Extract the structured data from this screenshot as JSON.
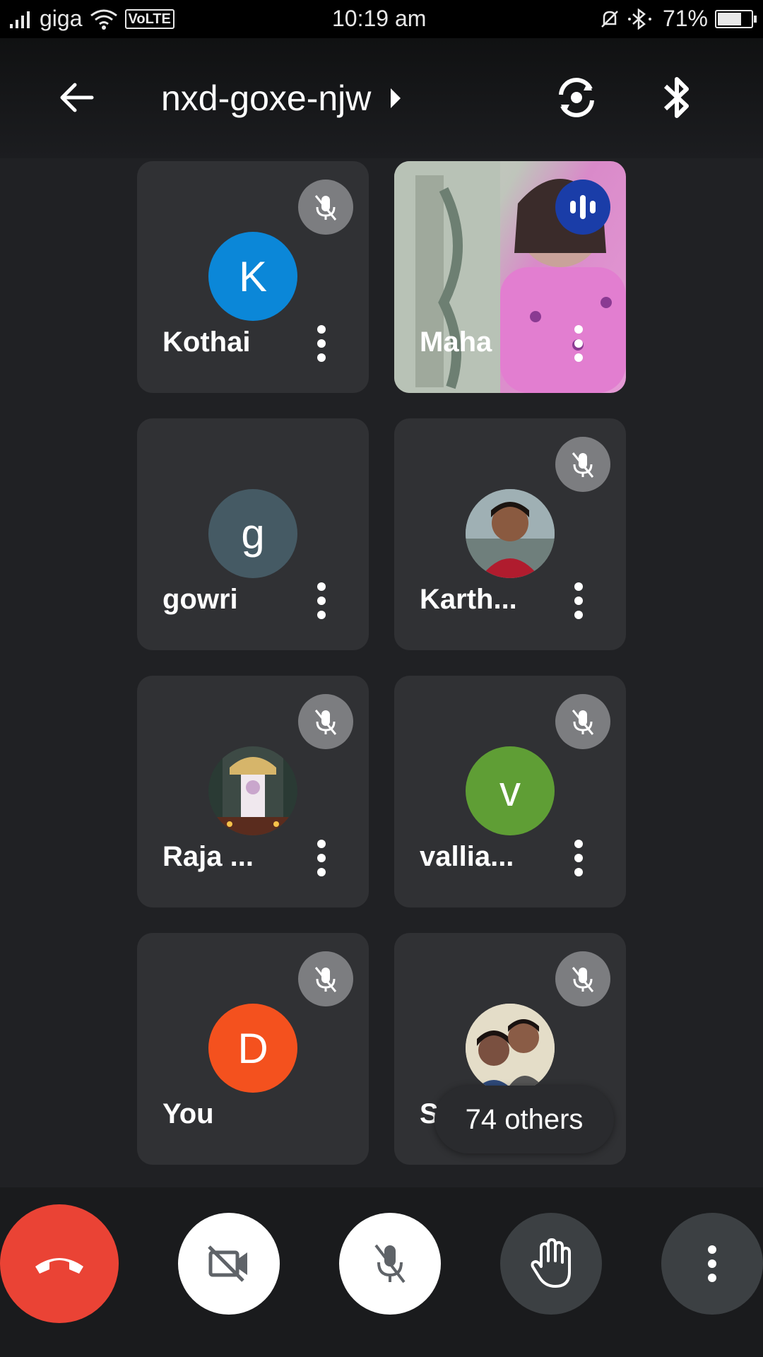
{
  "status_bar": {
    "carrier": "giga",
    "network_badge": "VoLTE",
    "time": "10:19 am",
    "battery": "71%",
    "battery_level": 0.71
  },
  "meeting": {
    "code": "nxd-goxe-njw"
  },
  "participants": [
    {
      "name": "Kothai",
      "initial": "K",
      "avatar_color": "#0b87d8",
      "muted": true,
      "speaking": false
    },
    {
      "name": "Maha",
      "initial": "",
      "avatar_color": "",
      "muted": false,
      "speaking": true,
      "video": true
    },
    {
      "name": "gowri",
      "initial": "g",
      "avatar_color": "#455a64",
      "muted": false,
      "speaking": false
    },
    {
      "name": "Karth...",
      "initial": "",
      "avatar_color": "",
      "muted": true,
      "speaking": false,
      "photo": "profile-photo"
    },
    {
      "name": "Raja ...",
      "initial": "",
      "avatar_color": "",
      "muted": true,
      "speaking": false,
      "photo": "profile-photo"
    },
    {
      "name": "vallia...",
      "initial": "v",
      "avatar_color": "#5f9e35",
      "muted": true,
      "speaking": false
    },
    {
      "name": "You",
      "initial": "D",
      "avatar_color": "#f4511e",
      "muted": true,
      "speaking": false
    },
    {
      "name": "Sw",
      "initial": "",
      "avatar_color": "",
      "muted": true,
      "speaking": false,
      "photo": "profile-photo"
    }
  ],
  "others_label": "74 others",
  "controls": {
    "end_call_color": "#ea4335",
    "camera": "camera-off-icon",
    "mic": "mic-off-icon",
    "raise_hand": "hand-icon",
    "more": "more-vert-icon"
  }
}
